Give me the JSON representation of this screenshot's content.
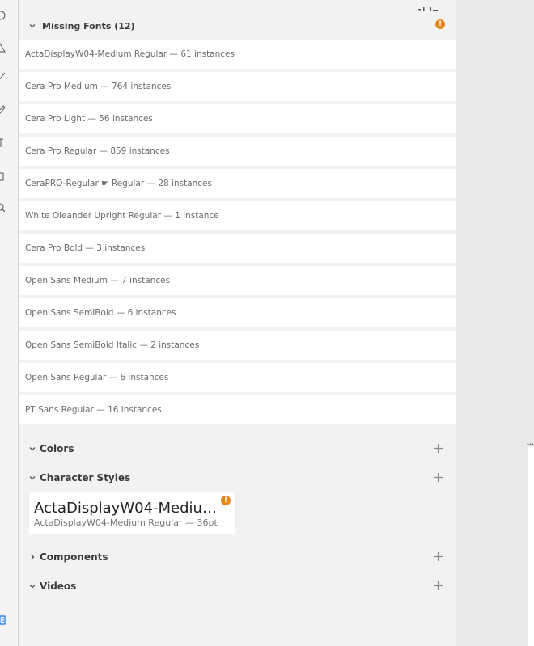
{
  "missing_fonts": {
    "title": "Missing Fonts (12)",
    "warning_glyph": "!",
    "items": [
      "ActaDisplayW04-Medium Regular — 61 instances",
      "Cera Pro Medium — 764 instances",
      "Cera Pro Light — 56 instances",
      "Cera Pro Regular — 859 instances",
      "CeraPRO-Regular ☛ Regular — 28 instances",
      "White Oleander Upright Regular — 1 instance",
      "Cera Pro Bold — 3 instances",
      "Open Sans Medium — 7 instances",
      "Open Sans SemiBold — 6 instances",
      "Open Sans SemiBold Italic — 2 instances",
      "Open Sans Regular — 6 instances",
      "PT Sans Regular — 16 instances"
    ]
  },
  "colors": {
    "title": "Colors"
  },
  "character_styles": {
    "title": "Character Styles",
    "style": {
      "name": "ActaDisplayW04-Medium...",
      "description": "ActaDisplayW04-Medium Regular — 36pt",
      "warning_glyph": "!"
    }
  },
  "components": {
    "title": "Components"
  },
  "videos": {
    "title": "Videos"
  },
  "theme": {
    "warning_color": "#e68619",
    "accent_blue": "#1473e6"
  }
}
